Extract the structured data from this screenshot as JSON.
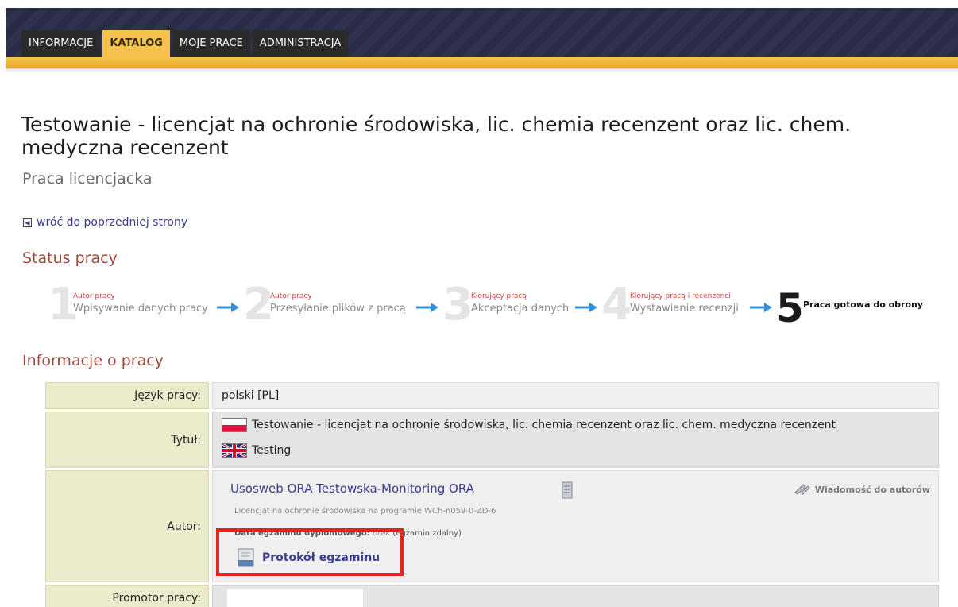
{
  "nav": {
    "tabs": [
      {
        "label": "INFORMACJE",
        "active": false
      },
      {
        "label": "KATALOG",
        "active": true
      },
      {
        "label": "MOJE PRACE",
        "active": false
      },
      {
        "label": "ADMINISTRACJA",
        "active": false
      }
    ]
  },
  "page": {
    "title": "Testowanie - licencjat na ochronie środowiska, lic. chemia recenzent oraz lic. chem. medyczna recenzent",
    "subtitle": "Praca licencjacka",
    "back_link": "wróć do poprzedniej strony"
  },
  "status": {
    "heading": "Status pracy",
    "steps": [
      {
        "number": "1",
        "role": "Autor pracy",
        "label": "Wpisywanie danych pracy",
        "current": false
      },
      {
        "number": "2",
        "role": "Autor pracy",
        "label": "Przesyłanie plików z pracą",
        "current": false
      },
      {
        "number": "3",
        "role": "Kierujący pracą",
        "label": "Akceptacja danych",
        "current": false
      },
      {
        "number": "4",
        "role": "Kierujący pracą i recenzenci",
        "label": "Wystawianie recenzji",
        "current": false
      },
      {
        "number": "5",
        "role": "",
        "label": "Praca gotowa do obrony",
        "current": true
      }
    ]
  },
  "info": {
    "heading": "Informacje o pracy",
    "language_label": "Język pracy:",
    "language_value": "polski [PL]",
    "title_label": "Tytuł:",
    "title_pl": "Testowanie - licencjat na ochronie środowiska, lic. chemia recenzent oraz lic. chem. medyczna recenzent",
    "title_en": "Testing",
    "author_label": "Autor:",
    "author_name": "Usosweb ORA Testowska-Monitoring ORA",
    "author_program": "Licencjat na ochronie środowiska na programie WCh-n059-0-ZD-6",
    "exam_date_label": "Data egzaminu dyplomowego:",
    "exam_date_value": "brak",
    "exam_date_note": "(egzamin zdalny)",
    "protocol_label": "Protokół egzaminu",
    "message_label": "Wiadomość do autorów",
    "promoter_label": "Promotor pracy:"
  },
  "colors": {
    "nav_bg": "#2a2c45",
    "nav_accent": "#f5c34c",
    "link": "#3b3d8f",
    "section_heading": "#9a4a3c",
    "step_role": "#b94a3a",
    "arrow": "#2f8fd8",
    "highlight": "#e2231a",
    "label_cell_bg": "#ebeacb"
  },
  "icons": [
    "back-arrow-icon",
    "step-arrow-icon",
    "flag-pl-icon",
    "flag-uk-icon",
    "document-icon",
    "protocol-document-icon",
    "message-icon"
  ]
}
